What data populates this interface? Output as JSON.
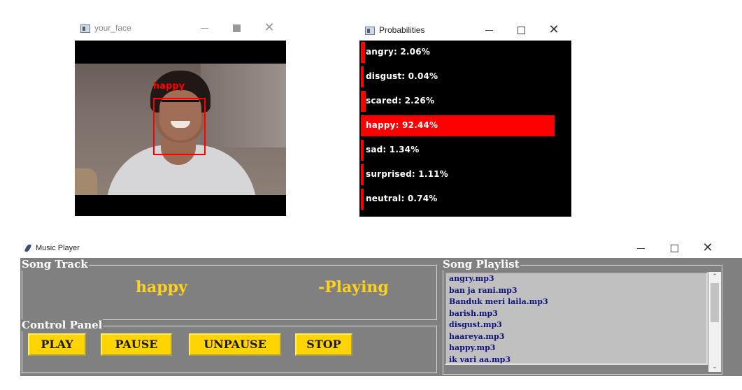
{
  "face_window": {
    "title": "your_face",
    "detected_label": "happy"
  },
  "prob_window": {
    "title": "Probabilities",
    "rows": [
      {
        "label": "angry: 2.06%",
        "value": 0.0206
      },
      {
        "label": "disgust: 0.04%",
        "value": 0.0004
      },
      {
        "label": "scared: 2.26%",
        "value": 0.0226
      },
      {
        "label": "happy: 92.44%",
        "value": 0.9244
      },
      {
        "label": "sad: 1.34%",
        "value": 0.0134
      },
      {
        "label": "surprised: 1.11%",
        "value": 0.0111
      },
      {
        "label": "neutral: 0.74%",
        "value": 0.0074
      }
    ],
    "bar_color": "#ff0000"
  },
  "music_player": {
    "title": "Music Player",
    "song_track": {
      "group_title": "Song Track",
      "current_song": "happy",
      "status": "-Playing"
    },
    "control_panel": {
      "group_title": "Control Panel",
      "play_label": "PLAY",
      "pause_label": "PAUSE",
      "unpause_label": "UNPAUSE",
      "stop_label": "STOP"
    },
    "playlist": {
      "group_title": "Song Playlist",
      "items": [
        "angry.mp3",
        "ban ja rani.mp3",
        "Banduk meri laila.mp3",
        "barish.mp3",
        "disgust.mp3",
        "haareya.mp3",
        "happy.mp3",
        "ik vari aa.mp3"
      ]
    },
    "colors": {
      "background": "#808080",
      "button": "#ffd400",
      "status_text": "#ffd21a",
      "list_text": "#12127a"
    }
  },
  "window_controls": {
    "minimize": "minimize-icon",
    "maximize": "maximize-icon",
    "close_glyph": "✕"
  }
}
